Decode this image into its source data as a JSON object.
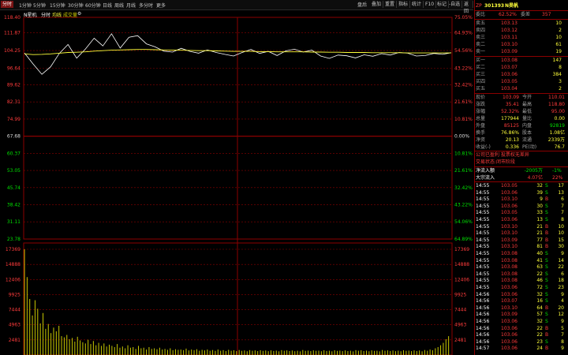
{
  "toolbar": {
    "tabs": [
      "分时",
      "1分钟",
      "5分钟",
      "15分钟",
      "30分钟",
      "60分钟",
      "日线",
      "周线",
      "月线",
      "多分时",
      "更多"
    ],
    "right_buttons": [
      "叠加",
      "重置",
      "指标",
      "统计",
      "F10",
      "标记",
      "-自选",
      "返回"
    ],
    "right_prefix": "盘后"
  },
  "subbar": {
    "label_a": "N星机",
    "label_b": "分时",
    "label_c": "均线",
    "label_d": "成交量"
  },
  "price_axis": {
    "left": [
      "118.40",
      "111.87",
      "104.25",
      "96.64",
      "89.62",
      "82.31",
      "74.99",
      "67.68",
      "60.37",
      "53.05",
      "45.74",
      "38.42",
      "31.11",
      "23.78"
    ],
    "right": [
      "75.05%",
      "64.93%",
      "54.56%",
      "43.22%",
      "32.42%",
      "21.61%",
      "10.81%",
      "0.00%",
      "10.81%",
      "21.61%",
      "32.42%",
      "43.22%",
      "54.06%",
      "64.89%"
    ]
  },
  "vol_axis": {
    "left": [
      "17369",
      "14888",
      "12406",
      "9925",
      "7444",
      "4963",
      "2481"
    ],
    "right": [
      "17369",
      "14888",
      "12406",
      "9925",
      "7444",
      "4963",
      "2481"
    ]
  },
  "chart_data": {
    "type": "line",
    "title": "",
    "prev_close": 67.68,
    "ylim": [
      23.78,
      118.4
    ],
    "series": [
      {
        "values": [
          103.2,
          98.5,
          94.1,
          97.3,
          103.0,
          106.8,
          101.0,
          104.9,
          109.5,
          106.2,
          111.4,
          105.3,
          109.9,
          110.6,
          107.1,
          105.8,
          104.0,
          103.6,
          105.2,
          103.9,
          103.1,
          104.5,
          103.4,
          102.6,
          101.9,
          103.4,
          104.7,
          103.0,
          103.9,
          102.1,
          104.1,
          104.8,
          103.6,
          104.4,
          101.9,
          100.9,
          102.3,
          102.0,
          101.1,
          102.4,
          101.8,
          102.9,
          102.3,
          103.4,
          103.1,
          101.9,
          102.1,
          103.0,
          102.6,
          103.3
        ]
      },
      {
        "values": [
          102.8,
          102.5,
          102.6,
          102.8,
          103.1,
          103.4,
          103.5,
          103.7,
          104.0,
          104.2,
          104.4,
          104.5,
          104.6,
          104.7,
          104.7,
          104.6,
          104.5,
          104.4,
          104.4,
          104.3,
          104.2,
          104.2,
          104.1,
          104.0,
          103.9,
          103.9,
          103.9,
          103.8,
          103.8,
          103.7,
          103.7,
          103.7,
          103.7,
          103.6,
          103.6,
          103.5,
          103.5,
          103.4,
          103.4,
          103.4,
          103.3,
          103.3,
          103.3,
          103.3,
          103.2,
          103.2,
          103.2,
          103.2,
          103.2,
          103.2
        ]
      }
    ],
    "volume": [
      17369,
      12800,
      9200,
      6500,
      9000,
      7600,
      5200,
      6900,
      4300,
      5100,
      3600,
      4500,
      3900,
      4800,
      3100,
      2900,
      3300,
      2600,
      2800,
      2200,
      3000,
      2400,
      2100,
      1900,
      2500,
      1800,
      2300,
      1600,
      2000,
      1500,
      1900,
      1400,
      1700,
      1500,
      1300,
      1800,
      1200,
      1400,
      1100,
      1600,
      1200,
      1300,
      1000,
      1500,
      1100,
      1200,
      900,
      1300,
      1000,
      1100,
      950,
      1200,
      900,
      1000,
      850,
      1100,
      800,
      950,
      850,
      900,
      800,
      1050,
      750,
      900,
      800,
      950,
      700,
      850,
      760,
      900,
      700,
      820,
      680,
      900,
      700,
      800,
      650,
      850,
      700,
      780,
      640,
      820,
      690,
      750,
      620,
      800,
      700,
      760,
      650,
      780,
      680,
      740,
      630,
      760,
      660,
      720,
      610,
      800,
      700,
      760,
      650,
      740,
      620,
      700,
      600,
      820,
      680,
      720,
      640,
      760,
      690,
      710,
      620,
      790,
      660,
      700,
      610,
      780,
      680,
      720,
      640,
      760,
      650,
      700,
      600,
      800,
      700,
      780,
      650,
      720,
      620,
      760,
      680,
      700,
      600,
      820,
      700,
      760,
      650,
      740,
      630,
      710,
      620,
      780,
      690,
      720,
      640,
      760,
      650,
      740,
      610,
      820,
      700,
      900,
      780,
      1100,
      1300,
      1600,
      2000,
      2600,
      3100
    ]
  },
  "quote": {
    "code": "301393",
    "name": "N昊帆",
    "code_prefix": "ZP",
    "rank_label": "委比",
    "rank_val": "62.52%",
    "diff_label": "委差",
    "diff_val": "357",
    "asks": [
      {
        "label": "卖五",
        "price": "103.13",
        "vol": "10"
      },
      {
        "label": "卖四",
        "price": "103.12",
        "vol": "2"
      },
      {
        "label": "卖三",
        "price": "103.11",
        "vol": "10"
      },
      {
        "label": "卖二",
        "price": "103.10",
        "vol": "61"
      },
      {
        "label": "卖一",
        "price": "103.09",
        "vol": "19"
      }
    ],
    "bids": [
      {
        "label": "买一",
        "price": "103.08",
        "vol": "147"
      },
      {
        "label": "买二",
        "price": "103.07",
        "vol": "8"
      },
      {
        "label": "买三",
        "price": "103.06",
        "vol": "384"
      },
      {
        "label": "买四",
        "price": "103.05",
        "vol": "3"
      },
      {
        "label": "买五",
        "price": "103.04",
        "vol": "2"
      }
    ],
    "stats": [
      {
        "l1": "现价",
        "v1": "103.09",
        "l2": "今开",
        "v2": "110.01"
      },
      {
        "l1": "涨跌",
        "v1": "35.41",
        "l2": "最高",
        "v2": "118.80"
      },
      {
        "l1": "涨幅",
        "v1": "52.32%",
        "l2": "最低",
        "v2": "95.00"
      },
      {
        "l1": "总量",
        "v1": "177944",
        "l2": "量比",
        "v2": "0.00"
      },
      {
        "l1": "外盘",
        "v1": "85125",
        "l2": "内盘",
        "v2": "92819"
      },
      {
        "l1": "换手",
        "v1": "76.86%",
        "l2": "股本",
        "v2": "1.08亿"
      },
      {
        "l1": "净资",
        "v1": "20.13",
        "l2": "流通",
        "v2": "2339万"
      },
      {
        "l1": "收益(-)",
        "v1": "0.336",
        "l2": "PE(动)",
        "v2": "76.7"
      }
    ],
    "info1": "公司已盈利 投票权无差异",
    "info2": "交易状态:闭市阶段",
    "flow": [
      {
        "label": "净流入额",
        "val": "-2005万",
        "pct": "-1%"
      },
      {
        "label": "大宗流入",
        "val": "4.07亿",
        "pct": "22%"
      }
    ],
    "ticks": [
      {
        "t": "14:55",
        "p": "103.05",
        "v": "32",
        "d": "S",
        "n": "17"
      },
      {
        "t": "14:55",
        "p": "103.06",
        "v": "39",
        "d": "S",
        "n": "13"
      },
      {
        "t": "14:55",
        "p": "103.10",
        "v": "9",
        "d": "B",
        "n": "6"
      },
      {
        "t": "14:55",
        "p": "103.06",
        "v": "30",
        "d": "S",
        "n": "7"
      },
      {
        "t": "14:55",
        "p": "103.05",
        "v": "33",
        "d": "S",
        "n": "7"
      },
      {
        "t": "14:55",
        "p": "103.06",
        "v": "13",
        "d": "S",
        "n": "8"
      },
      {
        "t": "14:55",
        "p": "103.10",
        "v": "21",
        "d": "B",
        "n": "10"
      },
      {
        "t": "14:55",
        "p": "103.10",
        "v": "21",
        "d": "B",
        "n": "10"
      },
      {
        "t": "14:55",
        "p": "103.09",
        "v": "77",
        "d": "B",
        "n": "15"
      },
      {
        "t": "14:55",
        "p": "103.10",
        "v": "81",
        "d": "B",
        "n": "30"
      },
      {
        "t": "14:55",
        "p": "103.08",
        "v": "40",
        "d": "S",
        "n": "9"
      },
      {
        "t": "14:55",
        "p": "103.08",
        "v": "41",
        "d": "S",
        "n": "14"
      },
      {
        "t": "14:55",
        "p": "103.08",
        "v": "63",
        "d": "S",
        "n": "22"
      },
      {
        "t": "14:55",
        "p": "103.08",
        "v": "22",
        "d": "S",
        "n": "6"
      },
      {
        "t": "14:55",
        "p": "103.08",
        "v": "46",
        "d": "S",
        "n": "18"
      },
      {
        "t": "14:55",
        "p": "103.06",
        "v": "72",
        "d": "S",
        "n": "23"
      },
      {
        "t": "14:56",
        "p": "103.06",
        "v": "32",
        "d": "S",
        "n": "9"
      },
      {
        "t": "14:56",
        "p": "103.07",
        "v": "16",
        "d": "S",
        "n": "4"
      },
      {
        "t": "14:56",
        "p": "103.10",
        "v": "64",
        "d": "B",
        "n": "20"
      },
      {
        "t": "14:56",
        "p": "103.09",
        "v": "57",
        "d": "S",
        "n": "12"
      },
      {
        "t": "14:56",
        "p": "103.06",
        "v": "32",
        "d": "S",
        "n": "9"
      },
      {
        "t": "14:56",
        "p": "103.06",
        "v": "22",
        "d": "B",
        "n": "5"
      },
      {
        "t": "14:56",
        "p": "103.06",
        "v": "22",
        "d": "B",
        "n": "7"
      },
      {
        "t": "14:56",
        "p": "103.06",
        "v": "23",
        "d": "S",
        "n": "8"
      },
      {
        "t": "14:57",
        "p": "103.06",
        "v": "24",
        "d": "B",
        "n": "9"
      }
    ]
  },
  "colors": {
    "up": "#ff3b3b",
    "down": "#00e000",
    "grid": "#8b0000",
    "price": "#ffffff",
    "avg": "#ffff3a",
    "vol": "#c8c800"
  }
}
